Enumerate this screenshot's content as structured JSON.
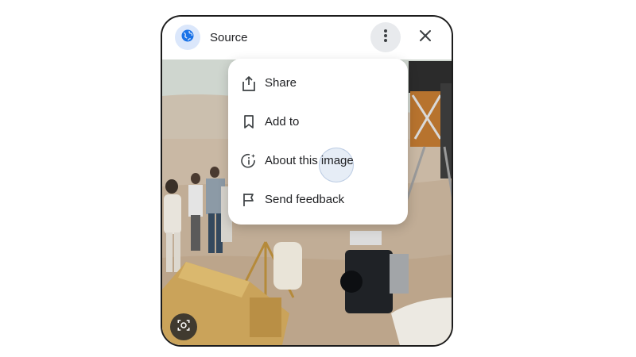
{
  "header": {
    "title": "Source",
    "site_icon": "globe-icon",
    "more_icon": "more-vert-icon",
    "close_icon": "close-icon"
  },
  "menu": {
    "items": [
      {
        "label": "Share",
        "icon": "share-icon"
      },
      {
        "label": "Add to",
        "icon": "bookmark-icon"
      },
      {
        "label": "About this image",
        "icon": "info-sparkle-icon"
      },
      {
        "label": "Send feedback",
        "icon": "flag-icon"
      }
    ]
  },
  "image": {
    "lens_icon": "lens-search-icon"
  },
  "colors": {
    "accent": "#1a73e8",
    "avatar_bg": "#dbe7fb",
    "more_bg": "#e8eaed",
    "text": "#202124"
  }
}
